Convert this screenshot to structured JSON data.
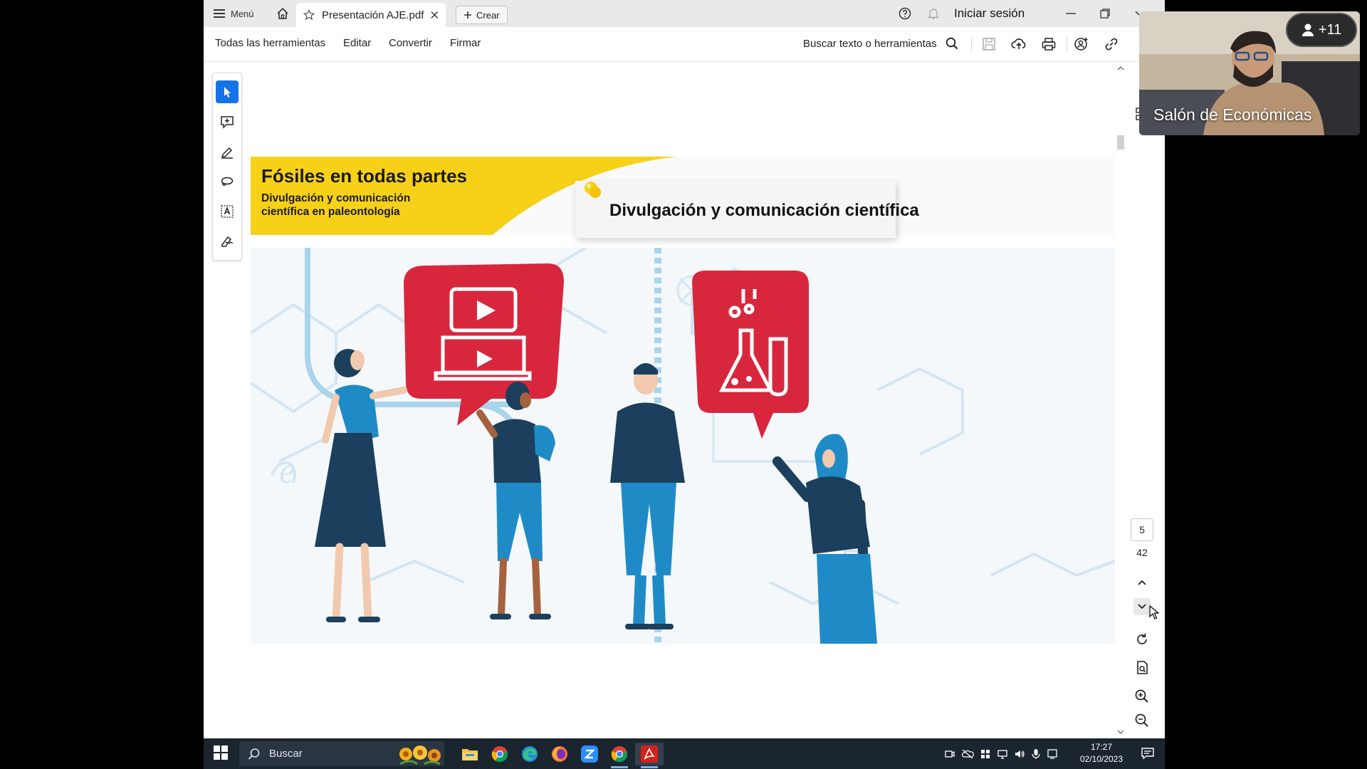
{
  "tabbar": {
    "menu_label": "Menú",
    "doc_tab_title": "Presentación AJE.pdf",
    "create_label": "Crear",
    "signin_label": "Iniciar sesión"
  },
  "toolbar": {
    "menu_items": [
      "Todas las herramientas",
      "Editar",
      "Convertir",
      "Firmar"
    ],
    "search_label": "Buscar texto o herramientas"
  },
  "palette": {
    "tools": [
      "select-tool-icon",
      "add-comment-icon",
      "highlight-pen-icon",
      "lasso-draw-icon",
      "text-box-icon",
      "fill-sign-icon"
    ],
    "active_index": 0
  },
  "document": {
    "header_title": "Fósiles en todas partes",
    "header_subtitle": "Divulgación y comunicación científica en paleontología",
    "topic_title": "Divulgación y comunicación científica",
    "colors": {
      "yellow": "#f7d117",
      "red": "#d8273d",
      "navy": "#1b3f5c",
      "blue": "#1f8bc6",
      "light_blue": "#a8d4ec"
    }
  },
  "navigation": {
    "current_page": "5",
    "total_pages": "42"
  },
  "webcam": {
    "room_label": "Salón de Económicas",
    "participants_badge": "+11"
  },
  "taskbar": {
    "search_placeholder": "Buscar",
    "apps": [
      "file-explorer-icon",
      "chrome-icon",
      "edge-icon",
      "firefox-icon",
      "zoom-icon",
      "chrome-icon",
      "acrobat-icon"
    ],
    "active_app": "acrobat-icon",
    "time": "17:27",
    "date": "02/10/2023"
  }
}
